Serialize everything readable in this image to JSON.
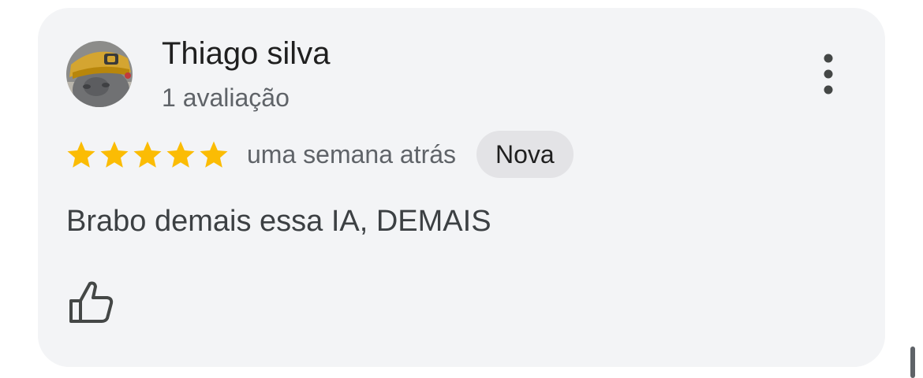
{
  "review": {
    "author_name": "Thiago silva",
    "review_count": "1 avaliação",
    "rating": 5,
    "rating_max": 5,
    "date": "uma semana atrás",
    "badge": "Nova",
    "text": "Brabo demais essa IA, DEMAIS"
  },
  "icons": {
    "avatar": "cat-with-yellow-cap-photo",
    "more": "more-vert-icon",
    "star": "star-icon",
    "like": "thumbs-up-icon"
  },
  "colors": {
    "card_background": "#f3f4f6",
    "star": "#fbbc04",
    "badge_background": "#e3e3e6",
    "primary_text": "#1f1f1f",
    "secondary_text": "#5f6368"
  }
}
